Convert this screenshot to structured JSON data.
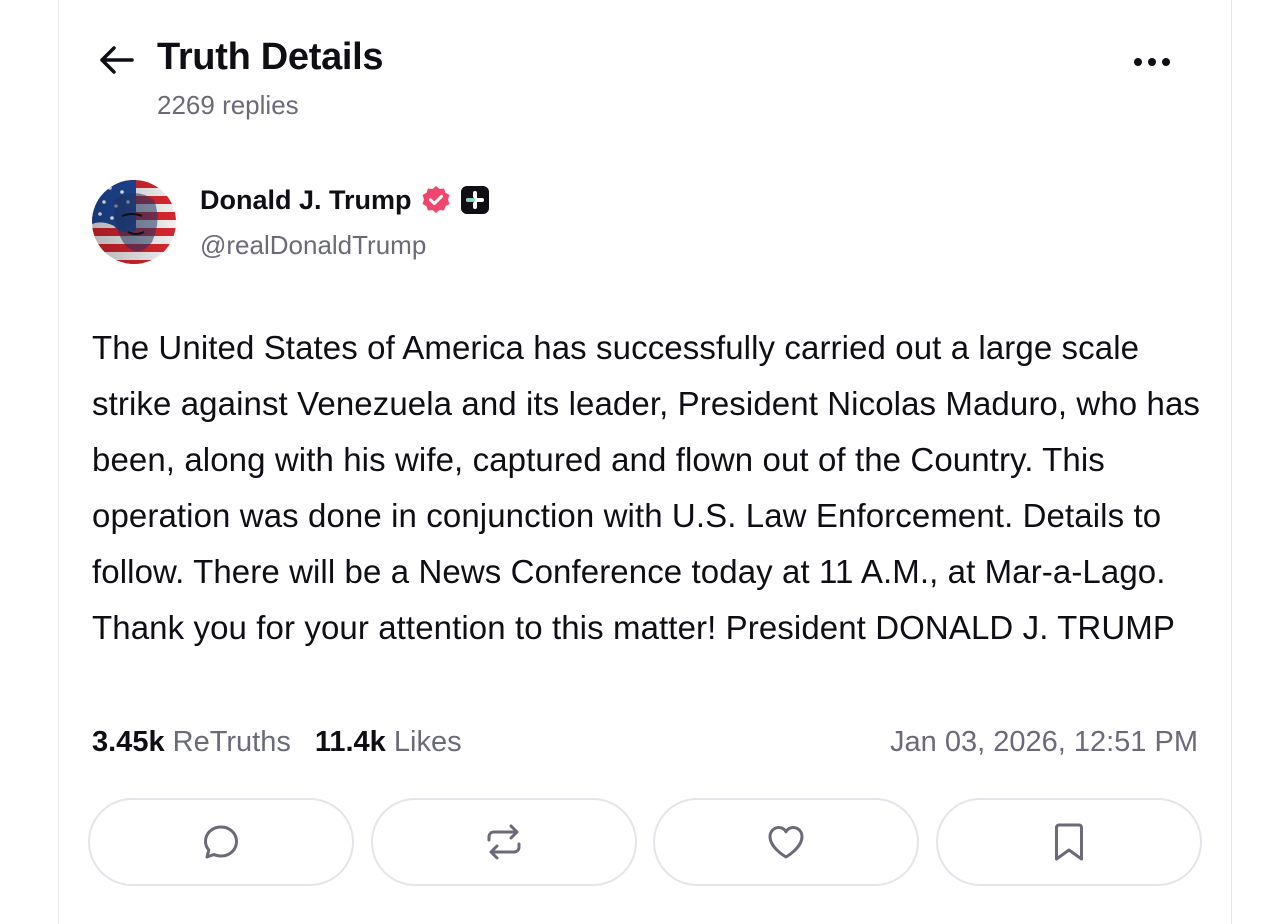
{
  "header": {
    "title": "Truth Details",
    "replies": "2269 replies"
  },
  "author": {
    "name": "Donald J. Trump",
    "handle": "@realDonaldTrump",
    "verified_color": "#f0466e"
  },
  "post": {
    "text": "The United States of America has successfully carried out a large scale strike against Venezuela and its leader, President Nicolas Maduro, who has been, along with his wife, captured and flown out of the Country. This operation was done in conjunction with U.S. Law Enforcement. Details to follow. There will be a News Conference today at 11 A.M., at Mar-a-Lago. Thank you for your attention to this matter! President DONALD J. TRUMP",
    "retruths_count": "3.45k",
    "retruths_label": "ReTruths",
    "likes_count": "11.4k",
    "likes_label": "Likes",
    "timestamp": "Jan 03, 2026, 12:51 PM"
  },
  "actions": {
    "icons": [
      "reply-icon",
      "retruth-icon",
      "like-icon",
      "bookmark-icon"
    ]
  }
}
